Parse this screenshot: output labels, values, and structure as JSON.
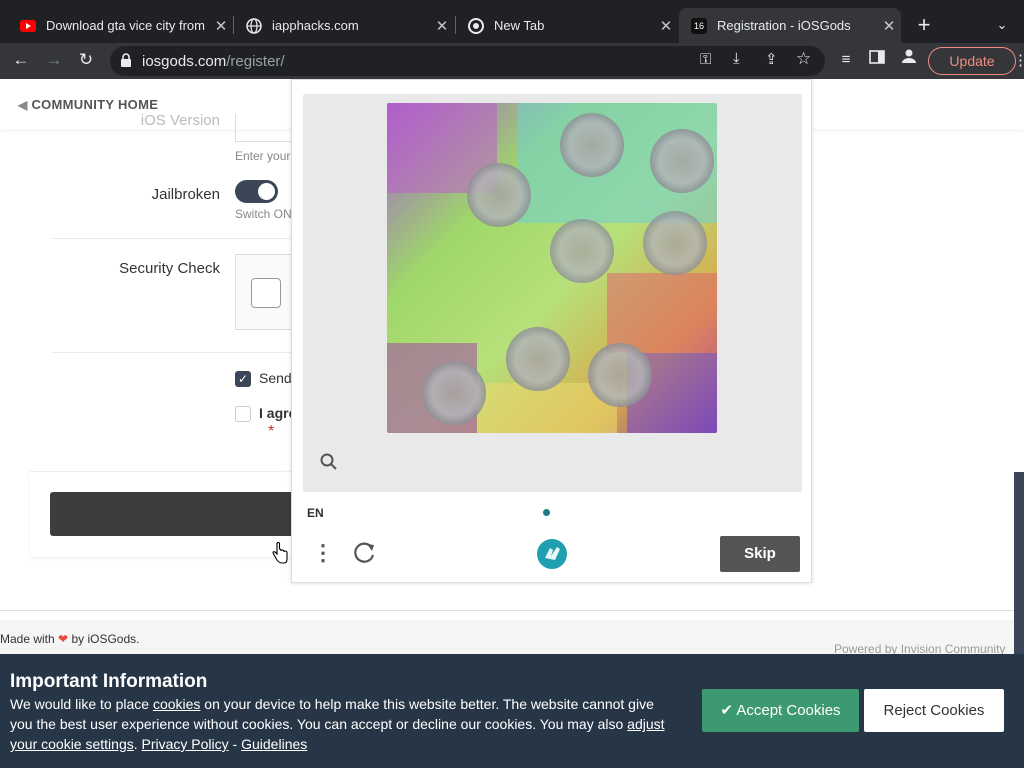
{
  "browser": {
    "tabs": [
      {
        "title": "Download gta vice city from"
      },
      {
        "title": "iapphacks.com"
      },
      {
        "title": "New Tab"
      },
      {
        "title": "Registration - iOSGods",
        "favicon_text": "16"
      }
    ],
    "url_host": "iosgods.com",
    "url_path": "/register/",
    "update_label": "Update"
  },
  "page": {
    "community_home": "COMMUNITY HOME",
    "ios_version_label": "iOS Version",
    "ios_version_hint": "Enter your",
    "jailbroken_label": "Jailbroken",
    "jailbroken_hint": "Switch ON",
    "security_check_label": "Security Check",
    "send_label": "Send",
    "agree_label": "I agre",
    "required_mark": "*",
    "footer_made_with": "Made with",
    "footer_by": "by iOSGods.",
    "footer_powered": "Powered by Invision Community"
  },
  "captcha": {
    "language": "EN",
    "skip_label": "Skip"
  },
  "cookies": {
    "title": "Important Information",
    "text_1": "We would like to place",
    "link_cookies": "cookies",
    "text_2": "on your device to help make this website better. The website cannot give you the best user experience without cookies. You can accept or decline our cookies. You may also",
    "link_adjust": "adjust your cookie settings",
    "link_privacy": "Privacy Policy",
    "separator": "-",
    "link_guidelines": "Guidelines",
    "accept_label": "Accept Cookies",
    "reject_label": "Reject Cookies",
    "accept_color": "#3d9970"
  }
}
